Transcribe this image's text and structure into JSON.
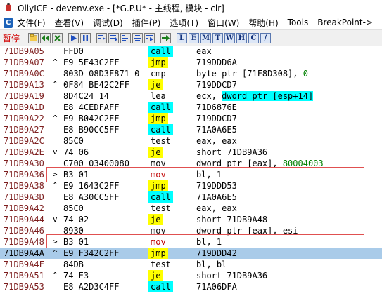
{
  "window": {
    "title": "OllyICE - devenv.exe - [*G.P.U* - 主线程, 模块 - clr]"
  },
  "menu": {
    "logo": "C",
    "items": [
      "文件(F)",
      "查看(V)",
      "调试(D)",
      "插件(P)",
      "选项(T)",
      "窗口(W)",
      "帮助(H)",
      "Tools",
      "BreakPoint->"
    ]
  },
  "toolbar": {
    "status": "暂停",
    "letters": [
      "L",
      "E",
      "M",
      "T",
      "W",
      "H",
      "C",
      "/"
    ]
  },
  "rows": [
    {
      "addr": "71DB9A05",
      "bracket": "",
      "bytes": "FFD0",
      "mnem": "call",
      "type": "call",
      "operand": "eax"
    },
    {
      "addr": "71DB9A07",
      "bracket": "^",
      "bytes": "E9 5E43C2FF",
      "mnem": "jmp",
      "type": "jmp",
      "operand": "719DDD6A"
    },
    {
      "addr": "71DB9A0C",
      "bracket": "",
      "bytes": "803D 08D3F871 0",
      "mnem": "cmp",
      "type": "plain",
      "operand": "byte ptr [71F8D308], ",
      "operand_num": "0"
    },
    {
      "addr": "71DB9A13",
      "bracket": "^",
      "bytes": "0F84 BE42C2FF",
      "mnem": "je",
      "type": "je",
      "operand": "719DDCD7"
    },
    {
      "addr": "71DB9A19",
      "bracket": "",
      "bytes": "8D4C24 14",
      "mnem": "lea",
      "type": "plain",
      "operand": "ecx, ",
      "operand_hl": "dword ptr [esp+14]"
    },
    {
      "addr": "71DB9A1D",
      "bracket": "",
      "bytes": "E8 4CEDFAFF",
      "mnem": "call",
      "type": "call",
      "operand": "71D6876E"
    },
    {
      "addr": "71DB9A22",
      "bracket": "^",
      "bytes": "E9 B042C2FF",
      "mnem": "jmp",
      "type": "jmp",
      "operand": "719DDCD7"
    },
    {
      "addr": "71DB9A27",
      "bracket": "",
      "bytes": "E8 B90CC5FF",
      "mnem": "call",
      "type": "call",
      "operand": "71A0A6E5"
    },
    {
      "addr": "71DB9A2C",
      "bracket": "",
      "bytes": "85C0",
      "mnem": "test",
      "type": "plain",
      "operand": "eax, eax"
    },
    {
      "addr": "71DB9A2E",
      "bracket": "v",
      "bytes": "74 06",
      "mnem": "je",
      "type": "je",
      "operand": "short 71DB9A36"
    },
    {
      "addr": "71DB9A30",
      "bracket": "",
      "bytes": "C700 03400080",
      "mnem": "mov",
      "type": "plain",
      "operand": "dword ptr [eax], ",
      "operand_num": "80004003"
    },
    {
      "addr": "71DB9A36",
      "bracket": ">",
      "bytes": "B3 01",
      "mnem": "mov",
      "type": "red",
      "operand": "bl, 1",
      "red": true
    },
    {
      "addr": "71DB9A38",
      "bracket": "^",
      "bytes": "E9 1643C2FF",
      "mnem": "jmp",
      "type": "jmp",
      "operand": "719DDD53"
    },
    {
      "addr": "71DB9A3D",
      "bracket": "",
      "bytes": "E8 A30CC5FF",
      "mnem": "call",
      "type": "call",
      "operand": "71A0A6E5"
    },
    {
      "addr": "71DB9A42",
      "bracket": "",
      "bytes": "85C0",
      "mnem": "test",
      "type": "plain",
      "operand": "eax, eax"
    },
    {
      "addr": "71DB9A44",
      "bracket": "v",
      "bytes": "74 02",
      "mnem": "je",
      "type": "je",
      "operand": "short 71DB9A48"
    },
    {
      "addr": "71DB9A46",
      "bracket": "",
      "bytes": "8930",
      "mnem": "mov",
      "type": "plain",
      "operand": "dword ptr [eax], esi"
    },
    {
      "addr": "71DB9A48",
      "bracket": ">",
      "bytes": "B3 01",
      "mnem": "mov",
      "type": "red",
      "operand": "bl, 1",
      "red": true
    },
    {
      "addr": "71DB9A4A",
      "bracket": "^",
      "bytes": "E9 F342C2FF",
      "mnem": "jmp",
      "type": "jmp",
      "operand": "719DDD42",
      "selected": true
    },
    {
      "addr": "71DB9A4F",
      "bracket": "",
      "bytes": "84DB",
      "mnem": "test",
      "type": "plain",
      "operand": "bl, bl"
    },
    {
      "addr": "71DB9A51",
      "bracket": "^",
      "bytes": "74 E3",
      "mnem": "je",
      "type": "je",
      "operand": "short 71DB9A36"
    },
    {
      "addr": "71DB9A53",
      "bracket": "",
      "bytes": "E8 A2D3C4FF",
      "mnem": "call",
      "type": "call",
      "operand": "71A06DFA"
    }
  ]
}
